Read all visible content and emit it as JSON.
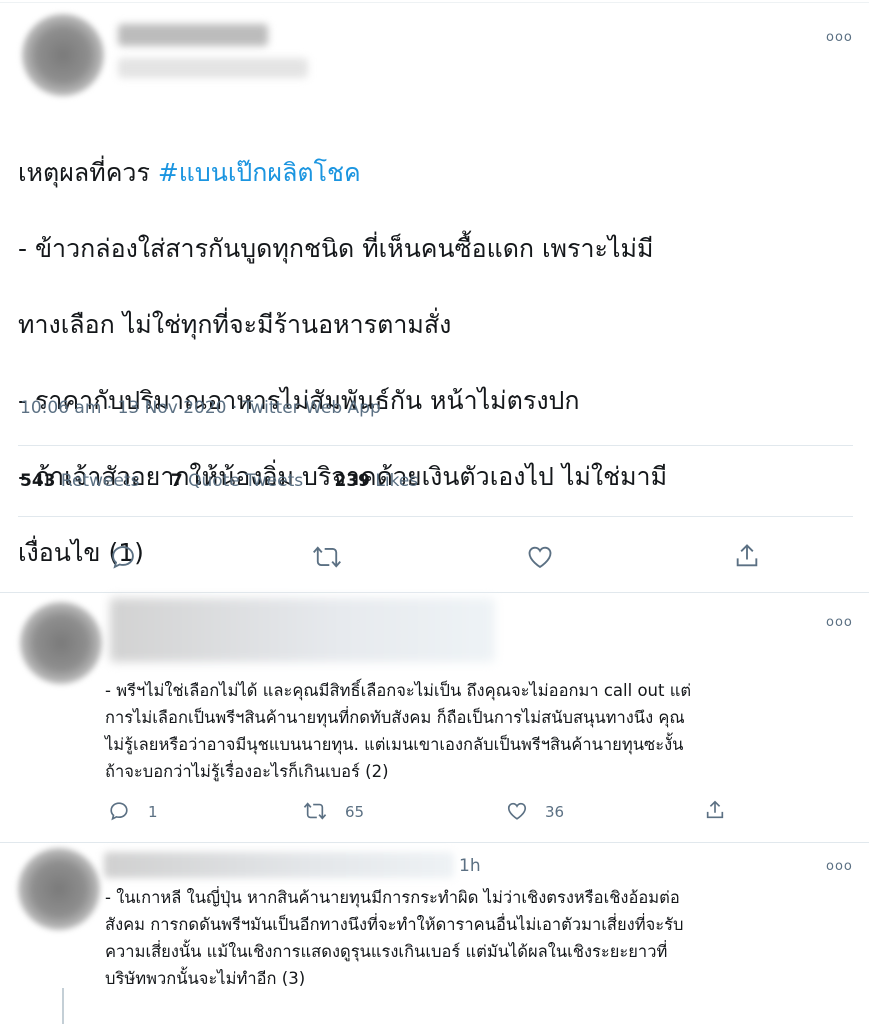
{
  "main_tweet": {
    "text_lines": [
      "เหตุผลที่ควร ",
      "- ข้าวกล่องใส่สารกันบูดทุกชนิด ที่เห็นคนซื้อแดก เพราะไม่มี",
      "ทางเลือก ไม่ใช่ทุกที่จะมีร้านอหารตามสั่ง",
      "- ราคากับปริมาณอาหารไม่สัมพันธ์กัน หน้าไม่ตรงปก",
      "- ถ้าเจ้าสัวอยากให้น้องอิ่ม บริจาคด้วยเงินตัวเองไป ไม่ใช่มามี",
      "เงื่อนไข (1)"
    ],
    "hashtag": "#แบนเป๊กผลิตโชค",
    "timestamp": "10:06 am · 13 Nov 2020 · Twitter Web App",
    "stats": {
      "retweets_count": "543",
      "retweets_label": "Retweets",
      "quotes_count": "7",
      "quotes_label": "Quote Tweets",
      "likes_count": "239",
      "likes_label": "Likes"
    },
    "more_label": "ooo"
  },
  "replies": [
    {
      "text_lines": [
        "- พรีฯไม่ใช่เลือกไม่ได้ และคุณมีสิทธิ์เลือกจะไม่เป็น ถึงคุณจะไม่ออกมา call out แต่",
        "การไม่เลือกเป็นพรีฯสินค้านายทุนที่กดทับสังคม ก็ถือเป็นการไม่สนับสนุนทางนึง คุณ",
        "ไม่รู้เลยหรือว่าอาจมีนุชแบนนายทุน. แต่เมนเขาเองกลับเป็นพรีฯสินค้านายทุนซะงั้น",
        "ถ้าจะบอกว่าไม่รู้เรื่องอะไรก็เกินเบอร์ (2)"
      ],
      "reply_count": "1",
      "retweet_count": "65",
      "like_count": "36",
      "more_label": "ooo"
    },
    {
      "time": "1h",
      "text_lines": [
        "- ในเกาหลี ในญี่ปุ่น หากสินค้านายทุนมีการกระทำผิด ไม่ว่าเชิงตรงหรือเชิงอ้อมต่อ",
        "สังคม การกดดันพรีฯมันเป็นอีกทางนึงที่จะทำให้ดาราคนอื่นไม่เอาตัวมาเสี่ยงที่จะรับ",
        "ความเสี่ยงนั้น แม้ในเชิงการแสดงดูรุนแรงเกินเบอร์ แต่มันได้ผลในเชิงระยะยาวที่",
        "บริษัทพวกนั้นจะไม่ทำอีก (3)"
      ],
      "more_label": "ooo"
    }
  ],
  "colors": {
    "hashtag": "#1b95e0",
    "secondary_text": "#5b7083",
    "divider": "#e1e8ed"
  }
}
